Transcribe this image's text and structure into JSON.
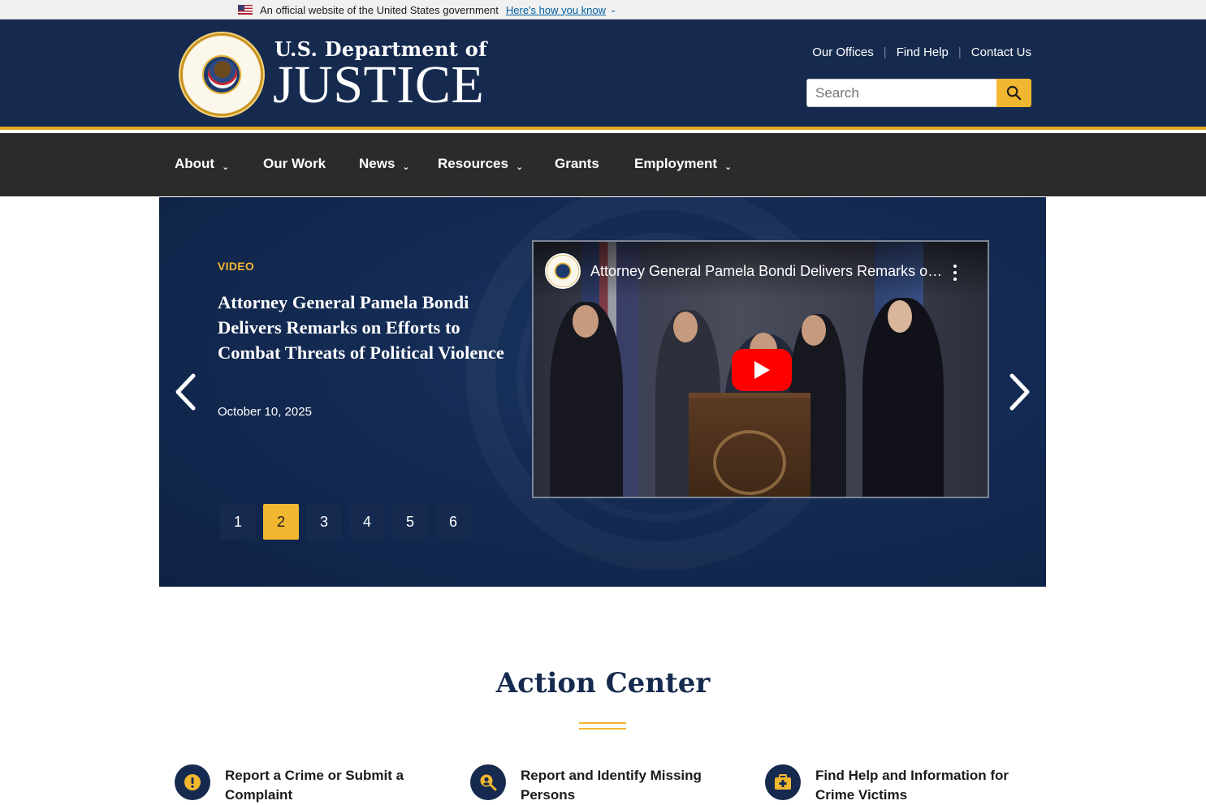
{
  "gov_banner": {
    "text": "An official website of the United States government",
    "link": "Here's how you know"
  },
  "header": {
    "brand_top": "U.S. Department of",
    "brand_main": "JUSTICE",
    "util_nav": [
      "Our Offices",
      "Find Help",
      "Contact Us"
    ],
    "search_placeholder": "Search"
  },
  "nav": {
    "items": [
      {
        "label": "About",
        "has_dropdown": true
      },
      {
        "label": "Our Work",
        "has_dropdown": false
      },
      {
        "label": "News",
        "has_dropdown": true
      },
      {
        "label": "Resources",
        "has_dropdown": true
      },
      {
        "label": "Grants",
        "has_dropdown": false
      },
      {
        "label": "Employment",
        "has_dropdown": true
      }
    ]
  },
  "hero": {
    "label": "VIDEO",
    "title": "Attorney General Pamela Bondi Delivers Remarks on Efforts to Combat Threats of Political Violence",
    "date": "October 10, 2025",
    "video_title": "Attorney General Pamela Bondi Delivers Remarks on Efforts to Combat Threats of Political Violence",
    "pages": [
      "1",
      "2",
      "3",
      "4",
      "5",
      "6"
    ],
    "active_page": "2"
  },
  "action_center": {
    "title": "Action Center",
    "cards": [
      {
        "label": "Report a Crime or Submit a Complaint",
        "icon": "alert-icon"
      },
      {
        "label": "Report and Identify Missing Persons",
        "icon": "search-person-icon"
      },
      {
        "label": "Find Help and Information for Crime Victims",
        "icon": "first-aid-icon"
      }
    ]
  },
  "colors": {
    "navy": "#152a4e",
    "gold": "#f2b731",
    "nav_bg": "#2b2b2b"
  }
}
